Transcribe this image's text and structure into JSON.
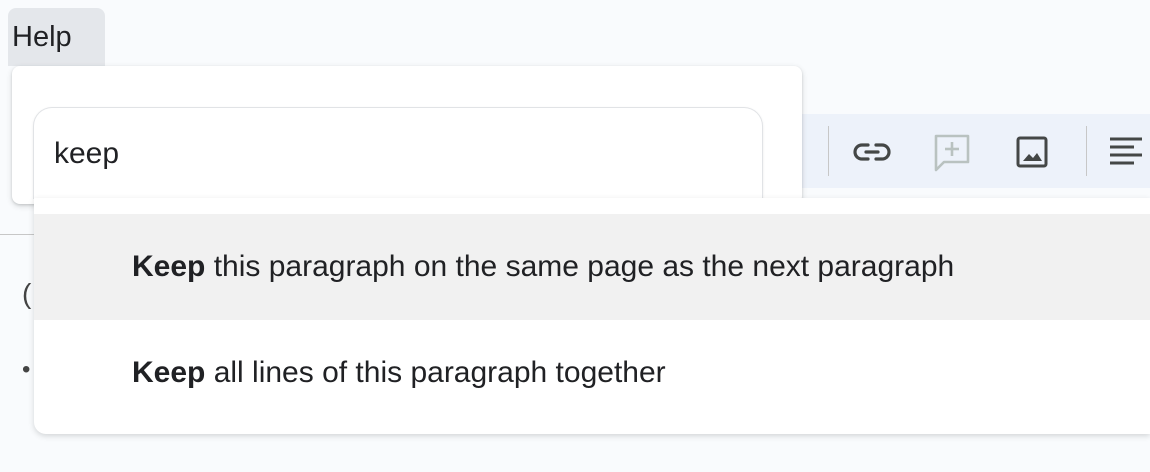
{
  "menu": {
    "help_label": "Help"
  },
  "search": {
    "value": "keep",
    "placeholder": ""
  },
  "results": [
    {
      "match": "Keep",
      "rest": " this paragraph on the same page as the next paragraph",
      "highlighted": true
    },
    {
      "match": "Keep",
      "rest": " all lines of this paragraph together",
      "highlighted": false
    }
  ],
  "toolbar": {
    "icons": [
      "link-icon",
      "add-comment-icon",
      "insert-image-icon",
      "align-left-icon"
    ]
  },
  "colors": {
    "toolbar_bg": "#edf2fa",
    "highlight": "#f1f1f1",
    "menu_active": "#e4e7eb"
  }
}
